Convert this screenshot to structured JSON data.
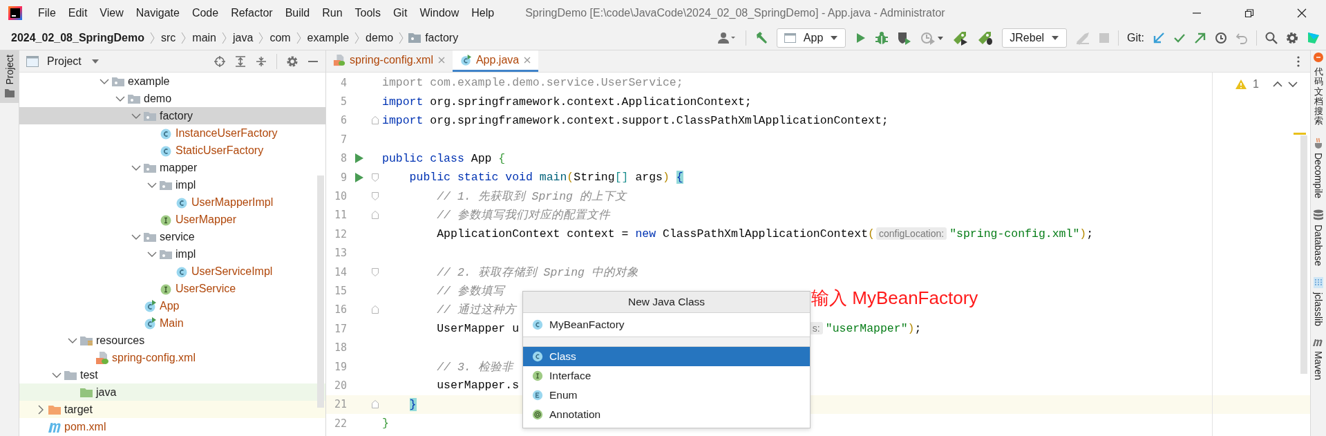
{
  "window": {
    "title": "SpringDemo [E:\\code\\JavaCode\\2024_02_08_SpringDemo] - App.java - Administrator"
  },
  "menu": [
    {
      "label": "File"
    },
    {
      "label": "Edit"
    },
    {
      "label": "View"
    },
    {
      "label": "Navigate"
    },
    {
      "label": "Code"
    },
    {
      "label": "Refactor"
    },
    {
      "label": "Build"
    },
    {
      "label": "Run"
    },
    {
      "label": "Tools"
    },
    {
      "label": "Git"
    },
    {
      "label": "Window"
    },
    {
      "label": "Help"
    }
  ],
  "breadcrumbs": [
    {
      "label": "2024_02_08_SpringDemo",
      "kind": "project"
    },
    {
      "label": "src",
      "kind": "dir"
    },
    {
      "label": "main",
      "kind": "dir"
    },
    {
      "label": "java",
      "kind": "dir"
    },
    {
      "label": "com",
      "kind": "dir"
    },
    {
      "label": "example",
      "kind": "dir"
    },
    {
      "label": "demo",
      "kind": "dir"
    },
    {
      "label": "factory",
      "kind": "package"
    }
  ],
  "toolbar": {
    "run_config": "App",
    "jrebel_config": "JRebel",
    "git_label": "Git:"
  },
  "project_panel": {
    "title": "Project",
    "side_tab": "Project"
  },
  "tree": [
    {
      "children": [
        {
          "children": [
            {
              "children": [
                {
                  "children": [
                    {
                      "label": "example",
                      "kind": "package",
                      "expanded": true,
                      "selected": false,
                      "unversioned": false,
                      "children": [
                        {
                          "label": "demo",
                          "kind": "package",
                          "expanded": true,
                          "selected": false,
                          "unversioned": false,
                          "children": [
                            {
                              "label": "factory",
                              "kind": "package",
                              "expanded": true,
                              "selected": true,
                              "unversioned": false,
                              "children": [
                                {
                                  "label": "InstanceUserFactory",
                                  "kind": "class",
                                  "selected": false,
                                  "unversioned": true
                                },
                                {
                                  "label": "StaticUserFactory",
                                  "kind": "class",
                                  "selected": false,
                                  "unversioned": true
                                }
                              ]
                            },
                            {
                              "label": "mapper",
                              "kind": "package",
                              "expanded": true,
                              "selected": false,
                              "unversioned": false,
                              "children": [
                                {
                                  "label": "impl",
                                  "kind": "package",
                                  "expanded": true,
                                  "selected": false,
                                  "unversioned": false,
                                  "children": [
                                    {
                                      "label": "UserMapperImpl",
                                      "kind": "class",
                                      "selected": false,
                                      "unversioned": true
                                    }
                                  ]
                                },
                                {
                                  "label": "UserMapper",
                                  "kind": "interface",
                                  "selected": false,
                                  "unversioned": true
                                }
                              ]
                            },
                            {
                              "label": "service",
                              "kind": "package",
                              "expanded": true,
                              "selected": false,
                              "unversioned": false,
                              "children": [
                                {
                                  "label": "impl",
                                  "kind": "package",
                                  "expanded": true,
                                  "selected": false,
                                  "unversioned": false,
                                  "children": [
                                    {
                                      "label": "UserServiceImpl",
                                      "kind": "class",
                                      "selected": false,
                                      "unversioned": true
                                    }
                                  ]
                                },
                                {
                                  "label": "UserService",
                                  "kind": "interface",
                                  "selected": false,
                                  "unversioned": true
                                }
                              ]
                            },
                            {
                              "label": "App",
                              "kind": "main-class",
                              "selected": false,
                              "unversioned": true
                            },
                            {
                              "label": "Main",
                              "kind": "main-class",
                              "selected": false,
                              "unversioned": true
                            }
                          ]
                        }
                      ]
                    }
                  ]
                }
              ]
            },
            {
              "label": "resources",
              "kind": "resources",
              "expanded": true,
              "selected": false,
              "unversioned": false,
              "children": [
                {
                  "label": "spring-config.xml",
                  "kind": "xml",
                  "selected": false,
                  "unversioned": true
                }
              ]
            }
          ]
        },
        {
          "label": "test",
          "kind": "folder",
          "expanded": true,
          "selected": false,
          "unversioned": false,
          "children": [
            {
              "label": "java",
              "kind": "test-folder",
              "selected": false,
              "unversioned": false,
              "test_scope": true
            }
          ]
        }
      ]
    },
    {
      "label": "target",
      "kind": "excluded-folder",
      "expanded": false,
      "selected": false,
      "unversioned": false,
      "excluded": true
    },
    {
      "label": "pom.xml",
      "kind": "maven",
      "selected": false,
      "unversioned": true
    }
  ],
  "tabs": [
    {
      "label": "spring-config.xml",
      "kind": "xml",
      "selected": false
    },
    {
      "label": "App.java",
      "kind": "main-class",
      "selected": true
    }
  ],
  "editor": {
    "warnings": "1",
    "lines": [
      {
        "n": "4",
        "current": false,
        "tokens": [
          {
            "kind": "unused",
            "t": "import com.example.demo.service.UserService;"
          }
        ]
      },
      {
        "n": "5",
        "current": false,
        "tokens": [
          {
            "kind": "kw",
            "t": "import"
          },
          {
            "kind": "p",
            "t": " org.springframework.context.ApplicationContext;"
          }
        ]
      },
      {
        "n": "6",
        "current": false,
        "fold_close": true,
        "tokens": [
          {
            "kind": "kw",
            "t": "import"
          },
          {
            "kind": "p",
            "t": " org.springframework.context.support.ClassPathXmlApplicationContext;"
          }
        ]
      },
      {
        "n": "7",
        "current": false
      },
      {
        "n": "8",
        "current": false,
        "run": true,
        "tokens": [
          {
            "kind": "kw",
            "t": "public class"
          },
          {
            "kind": "p",
            "t": " App "
          },
          {
            "kind": "br1",
            "t": "{"
          }
        ]
      },
      {
        "n": "9",
        "current": false,
        "run": true,
        "fold_open": true,
        "tokens": [
          {
            "kind": "kw",
            "t": "    public static void "
          },
          {
            "kind": "fn",
            "t": "main"
          },
          {
            "kind": "par",
            "t": "("
          },
          {
            "kind": "p",
            "t": "String"
          },
          {
            "kind": "brk",
            "t": "[]"
          },
          {
            "kind": "p",
            "t": " args"
          },
          {
            "kind": "par",
            "t": ") "
          },
          {
            "kind": "match",
            "t": "{"
          }
        ]
      },
      {
        "n": "10",
        "current": false,
        "fold_open": true,
        "tokens": [
          {
            "kind": "cm",
            "t": "        // 1. 先获取到 Spring 的上下文"
          }
        ]
      },
      {
        "n": "11",
        "current": false,
        "fold_close": true,
        "tokens": [
          {
            "kind": "cm",
            "t": "        // 参数填写我们对应的配置文件"
          }
        ]
      },
      {
        "n": "12",
        "current": false,
        "tokens": [
          {
            "kind": "p",
            "t": "        ApplicationContext context = "
          },
          {
            "kind": "kw",
            "t": "new"
          },
          {
            "kind": "p",
            "t": " ClassPathXmlApplicationContext"
          },
          {
            "kind": "par",
            "t": "("
          },
          {
            "kind": "hint",
            "t": "configLocation:"
          },
          {
            "kind": "str",
            "t": "\"spring-config.xml\""
          },
          {
            "kind": "par",
            "t": ")"
          },
          {
            "kind": "p",
            "t": ";"
          }
        ]
      },
      {
        "n": "13",
        "current": false
      },
      {
        "n": "14",
        "current": false,
        "fold_open": true,
        "tokens": [
          {
            "kind": "cm",
            "t": "        // 2. 获取存储到 Spring 中的对象"
          }
        ]
      },
      {
        "n": "15",
        "current": false,
        "tokens": [
          {
            "kind": "cm",
            "t": "        // 参数填写"
          }
        ]
      },
      {
        "n": "16",
        "current": false,
        "fold_close": true,
        "tokens": [
          {
            "kind": "cm",
            "t": "        // 通过这种方"
          }
        ]
      },
      {
        "n": "17",
        "current": false,
        "tokens": [
          {
            "kind": "p",
            "t": "        UserMapper u"
          }
        ],
        "tail": [
          {
            "kind": "hint",
            "t": "s:"
          },
          {
            "kind": "str",
            "t": "\"userMapper\""
          },
          {
            "kind": "par",
            "t": ")"
          },
          {
            "kind": "p",
            "t": ";"
          }
        ]
      },
      {
        "n": "18",
        "current": false
      },
      {
        "n": "19",
        "current": false,
        "tokens": [
          {
            "kind": "cm",
            "t": "        // 3. 检验非"
          }
        ]
      },
      {
        "n": "20",
        "current": false,
        "tokens": [
          {
            "kind": "p",
            "t": "        userMapper.s"
          }
        ]
      },
      {
        "n": "21",
        "current": true,
        "fold_close": true,
        "tokens": [
          {
            "kind": "match",
            "t": "    }"
          }
        ]
      },
      {
        "n": "22",
        "current": false,
        "tokens": [
          {
            "kind": "br1",
            "t": "}"
          }
        ]
      }
    ]
  },
  "popup": {
    "title": "New Java Class",
    "value": "MyBeanFactory",
    "items": [
      {
        "label": "Class",
        "kind": "class",
        "selected": true
      },
      {
        "label": "Interface",
        "kind": "interface",
        "selected": false
      },
      {
        "label": "Enum",
        "kind": "enum",
        "selected": false
      },
      {
        "label": "Annotation",
        "kind": "annotation",
        "selected": false
      }
    ]
  },
  "annotation": "输入 MyBeanFactory",
  "right_tools": [
    {
      "label": "代码文档搜索",
      "kind": "cjk"
    },
    {
      "label": "Decompile",
      "kind": "decompile"
    },
    {
      "label": "Database",
      "kind": "database"
    },
    {
      "label": "jclasslib",
      "kind": "jclasslib"
    },
    {
      "label": "Maven",
      "kind": "maven"
    }
  ]
}
